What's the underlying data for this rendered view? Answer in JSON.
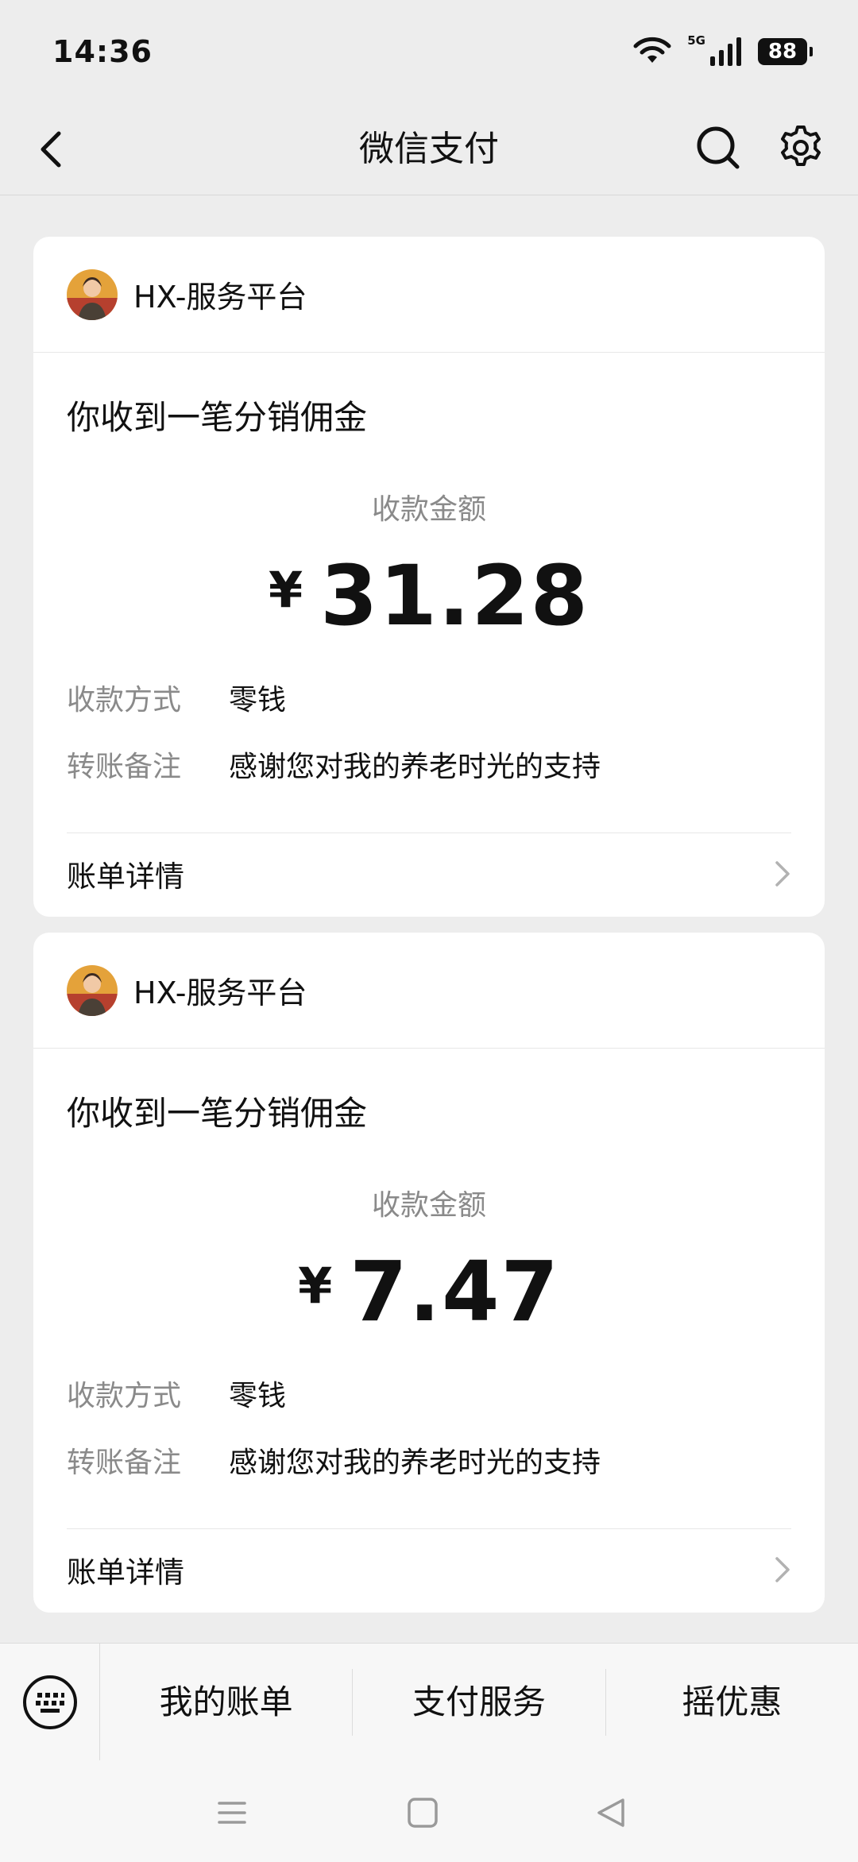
{
  "status_bar": {
    "time": "14:36",
    "network": "5G",
    "battery": "88",
    "icons": [
      "wifi-icon",
      "signal-icon"
    ]
  },
  "nav": {
    "title": "微信支付",
    "icons": [
      "back-icon",
      "search-icon",
      "gear-icon"
    ]
  },
  "cards": [
    {
      "merchant": "HX-服务平台",
      "title": "你收到一笔分销佣金",
      "amount_label": "收款金额",
      "currency": "¥",
      "amount": "31.28",
      "method_label": "收款方式",
      "method_value": "零钱",
      "note_label": "转账备注",
      "note_value": "感谢您对我的养老时光的支持",
      "detail_label": "账单详情"
    },
    {
      "merchant": "HX-服务平台",
      "title": "你收到一笔分销佣金",
      "amount_label": "收款金额",
      "currency": "¥",
      "amount": "7.47",
      "method_label": "收款方式",
      "method_value": "零钱",
      "note_label": "转账备注",
      "note_value": "感谢您对我的养老时光的支持",
      "detail_label": "账单详情"
    }
  ],
  "bottom_menu": {
    "items": [
      "我的账单",
      "支付服务",
      "摇优惠"
    ]
  },
  "colors": {
    "background": "#ededed",
    "card": "#ffffff",
    "secondary_text": "#8a8a8a",
    "primary_text": "#111111"
  }
}
